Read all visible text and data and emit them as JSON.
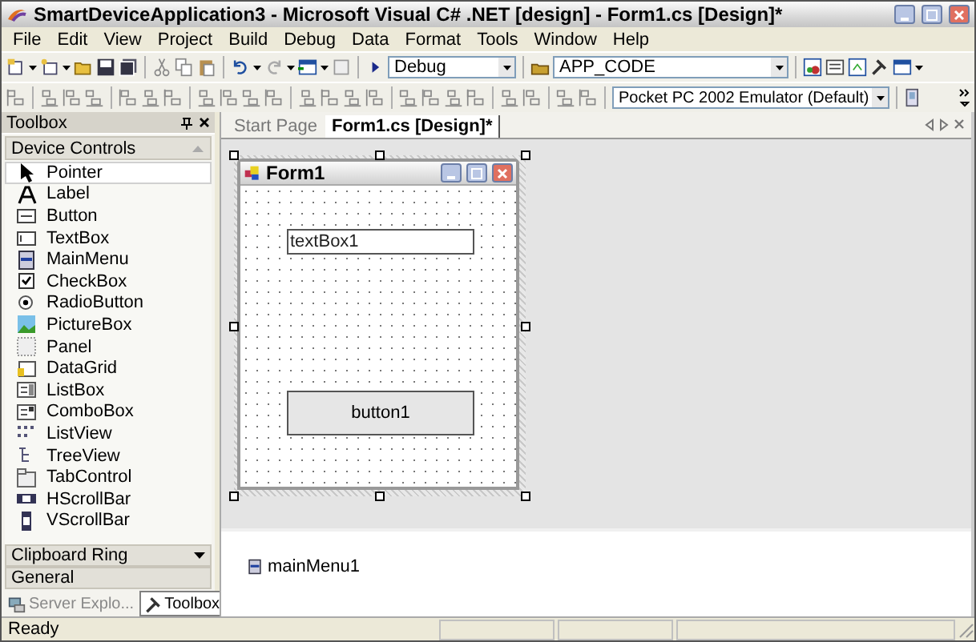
{
  "window": {
    "title": "SmartDeviceApplication3 - Microsoft Visual C# .NET [design] - Form1.cs [Design]*"
  },
  "menu": [
    "File",
    "Edit",
    "View",
    "Project",
    "Build",
    "Debug",
    "Data",
    "Format",
    "Tools",
    "Window",
    "Help"
  ],
  "standard_toolbar": {
    "configuration": "Debug",
    "project_combo": "APP_CODE"
  },
  "layout_toolbar": {
    "device": "Pocket PC 2002 Emulator (Default)"
  },
  "toolbox": {
    "title": "Toolbox",
    "group": "Device Controls",
    "items": [
      {
        "label": "Pointer",
        "selected": true
      },
      {
        "label": "Label",
        "selected": false
      },
      {
        "label": "Button",
        "selected": false
      },
      {
        "label": "TextBox",
        "selected": false
      },
      {
        "label": "MainMenu",
        "selected": false
      },
      {
        "label": "CheckBox",
        "selected": false
      },
      {
        "label": "RadioButton",
        "selected": false
      },
      {
        "label": "PictureBox",
        "selected": false
      },
      {
        "label": "Panel",
        "selected": false
      },
      {
        "label": "DataGrid",
        "selected": false
      },
      {
        "label": "ListBox",
        "selected": false
      },
      {
        "label": "ComboBox",
        "selected": false
      },
      {
        "label": "ListView",
        "selected": false
      },
      {
        "label": "TreeView",
        "selected": false
      },
      {
        "label": "TabControl",
        "selected": false
      },
      {
        "label": "HScrollBar",
        "selected": false
      },
      {
        "label": "VScrollBar",
        "selected": false
      }
    ],
    "sections": [
      "Clipboard Ring",
      "General"
    ],
    "tabs": [
      {
        "label": "Server Explo...",
        "selected": false
      },
      {
        "label": "Toolbox",
        "selected": true
      }
    ]
  },
  "documents": {
    "tabs": [
      {
        "label": "Start Page",
        "selected": false
      },
      {
        "label": "Form1.cs [Design]*",
        "selected": true
      }
    ]
  },
  "form": {
    "title": "Form1",
    "controls": [
      {
        "kind": "textbox",
        "text": "textBox1"
      },
      {
        "kind": "button",
        "text": "button1"
      }
    ]
  },
  "component_tray": [
    "mainMenu1"
  ],
  "status_bar": {
    "text": "Ready"
  }
}
